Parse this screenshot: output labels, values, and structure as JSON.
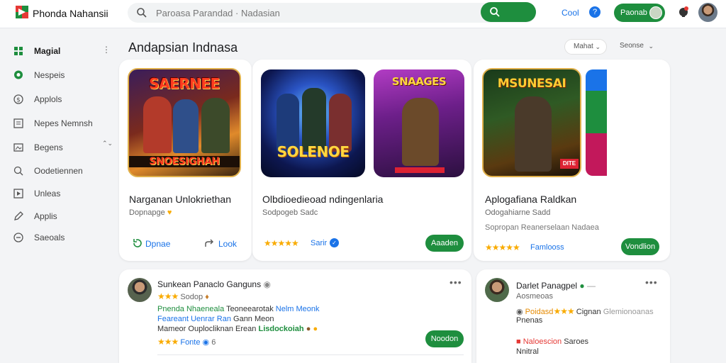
{
  "header": {
    "brand": "Phonda Nahansii",
    "search_placeholder": "Paroasa Parandad · Nadasian",
    "cool_label": "Cool",
    "promo_label": "Paonab"
  },
  "sidebar": {
    "items": [
      {
        "label": "Magial",
        "tail": "⋮"
      },
      {
        "label": "Nespeis",
        "tail": ""
      },
      {
        "label": "Applols",
        "tail": ""
      },
      {
        "label": "Nepes Nemnsh",
        "tail": ""
      },
      {
        "label": "Begens",
        "tail": "⌃⌄"
      },
      {
        "label": "Oodetiennen",
        "tail": ""
      },
      {
        "label": "Unleas",
        "tail": ""
      },
      {
        "label": "Applis",
        "tail": ""
      },
      {
        "label": "Saeoals",
        "tail": ""
      }
    ]
  },
  "section": {
    "title": "Andapsian Indnasa",
    "filter1": "Mahat",
    "filter2": "Seonse"
  },
  "games": [
    {
      "art_top": "SAERNEE",
      "art_bottom": "SNOESIGHAH",
      "name": "Narganan Unlokriethan",
      "sub": "Dopnapge",
      "action1": "Dpnae",
      "action2": "Look"
    },
    {
      "art_top": "",
      "art_bottom": "SOLENOE",
      "name": "Olbdioedieoad ndingenlaria",
      "sub": "Sodpogeb Sadc",
      "rating_text": "Sarir"
    },
    {
      "art_top": "SNAAGES",
      "art_bottom": "",
      "name": "",
      "sub": "",
      "button": "Aaaden"
    },
    {
      "art_top": "MSUNESAI",
      "art_bottom": "DITE",
      "name": "Aplogafiana Raldkan",
      "sub": "Odogahiarne Sadd",
      "desc": "Sopropan Reanerselaan Nadaea",
      "rating_text": "Famlooss",
      "button": "Vondlion"
    }
  ],
  "reviews": [
    {
      "name": "Sunkean Panaclo Ganguns",
      "meta": "Sodop",
      "line1_green": "Pnenda Nhaeneala",
      "line1_dark": "Teoneearotak",
      "line1_blue": "Nelm Meonk",
      "line2_blue": "Feareant Uenrar Ran",
      "line2_dark": "Gann Meon",
      "line3_dark": "Mameor Ouplocliknan Erean",
      "line3_green": "Lisdockoiah",
      "rating_text": "Fonte",
      "rating_num": "6",
      "button": "Noodon"
    },
    {
      "name": "Darlet Panagpel",
      "meta": "Aosmeoas",
      "line1_dark": "Poidasd",
      "line1_mid": "Cignan",
      "line1_gray": "Glemionoanas",
      "line2": "Pnenas",
      "line3_red": "Naloescion",
      "line3_dark": "Saroes",
      "line4": "Nnitral"
    }
  ],
  "colors": {
    "accent_green": "#1e8e3e",
    "link_blue": "#1a73e8",
    "star": "#f9ab00"
  }
}
